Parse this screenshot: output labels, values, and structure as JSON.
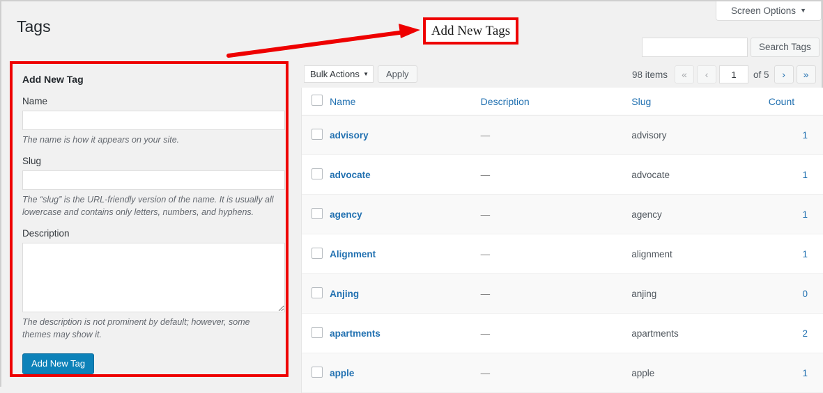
{
  "header": {
    "page_title": "Tags",
    "screen_options_label": "Screen Options",
    "screen_options_caret": "▼"
  },
  "search": {
    "value": "",
    "placeholder": "",
    "button_label": "Search Tags"
  },
  "toolbar": {
    "bulk_actions_label": "Bulk Actions",
    "bulk_caret": "▼",
    "apply_label": "Apply"
  },
  "pagination": {
    "items_count": "98 items",
    "first_label": "«",
    "prev_label": "‹",
    "current_page": "1",
    "of_label": "of 5",
    "next_label": "›",
    "last_label": "»"
  },
  "form": {
    "heading": "Add New Tag",
    "name_label": "Name",
    "name_value": "",
    "name_help": "The name is how it appears on your site.",
    "slug_label": "Slug",
    "slug_value": "",
    "slug_help": "The “slug” is the URL-friendly version of the name. It is usually all lowercase and contains only letters, numbers, and hyphens.",
    "description_label": "Description",
    "description_value": "",
    "description_help": "The description is not prominent by default; however, some themes may show it.",
    "submit_label": "Add New Tag"
  },
  "table": {
    "columns": {
      "name": "Name",
      "description": "Description",
      "slug": "Slug",
      "count": "Count"
    },
    "rows": [
      {
        "name": "advisory",
        "description": "—",
        "slug": "advisory",
        "count": "1"
      },
      {
        "name": "advocate",
        "description": "—",
        "slug": "advocate",
        "count": "1"
      },
      {
        "name": "agency",
        "description": "—",
        "slug": "agency",
        "count": "1"
      },
      {
        "name": "Alignment",
        "description": "—",
        "slug": "alignment",
        "count": "1"
      },
      {
        "name": "Anjing",
        "description": "—",
        "slug": "anjing",
        "count": "0"
      },
      {
        "name": "apartments",
        "description": "—",
        "slug": "apartments",
        "count": "2"
      },
      {
        "name": "apple",
        "description": "—",
        "slug": "apple",
        "count": "1"
      }
    ]
  },
  "annotation": {
    "callout_text": "Add New Tags",
    "highlight_color": "#ee0000"
  }
}
